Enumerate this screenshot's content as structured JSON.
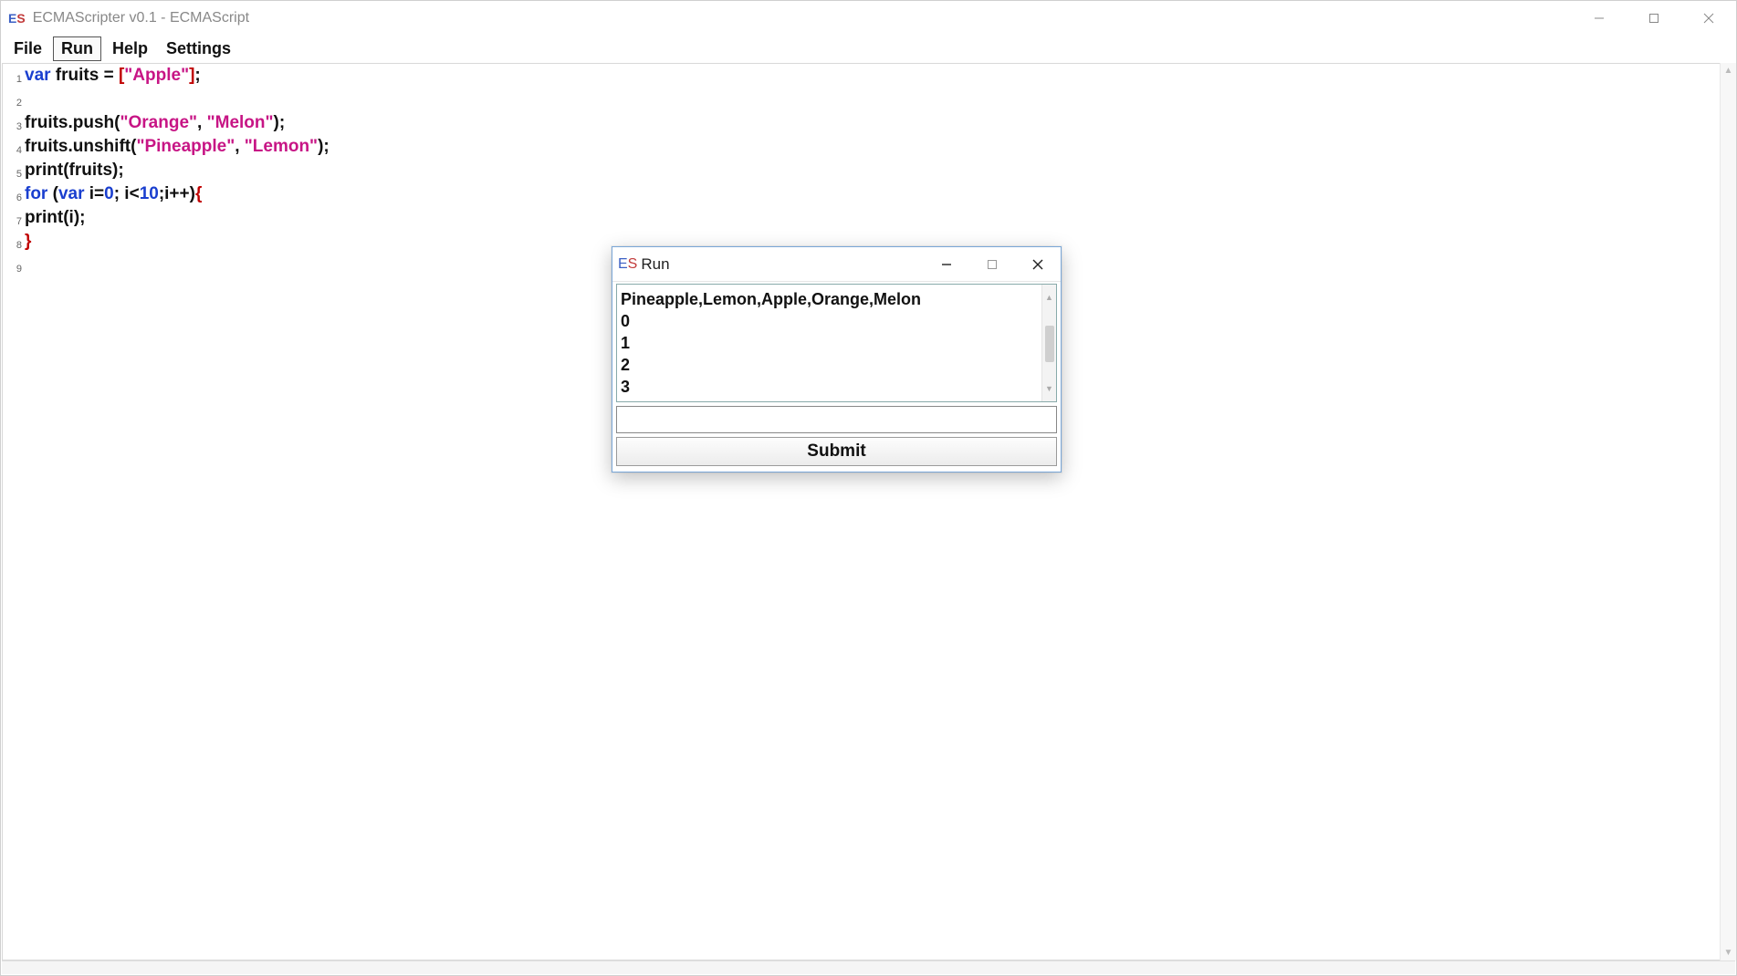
{
  "window": {
    "title": "ECMAScripter v0.1 - ECMAScript",
    "icon_text_E": "E",
    "icon_text_S": "S"
  },
  "menu": {
    "items": [
      "File",
      "Run",
      "Help",
      "Settings"
    ],
    "active_index": 1
  },
  "editor": {
    "line_numbers": [
      "1",
      "2",
      "3",
      "4",
      "5",
      "6",
      "7",
      "8",
      "9"
    ],
    "code_lines": [
      [
        {
          "t": "var",
          "c": "kw"
        },
        {
          "t": " fruits = ",
          "c": ""
        },
        {
          "t": "[",
          "c": "brace-red"
        },
        {
          "t": "\"Apple\"",
          "c": "str"
        },
        {
          "t": "]",
          "c": "brace-red"
        },
        {
          "t": ";",
          "c": "punct"
        }
      ],
      [],
      [
        {
          "t": "fruits.push",
          "c": ""
        },
        {
          "t": "(",
          "c": "punct"
        },
        {
          "t": "\"Orange\"",
          "c": "str"
        },
        {
          "t": ", ",
          "c": "punct"
        },
        {
          "t": "\"Melon\"",
          "c": "str"
        },
        {
          "t": ")",
          "c": "punct"
        },
        {
          "t": ";",
          "c": "punct"
        }
      ],
      [
        {
          "t": "fruits.unshift",
          "c": ""
        },
        {
          "t": "(",
          "c": "punct"
        },
        {
          "t": "\"Pineapple\"",
          "c": "str"
        },
        {
          "t": ", ",
          "c": "punct"
        },
        {
          "t": "\"Lemon\"",
          "c": "str"
        },
        {
          "t": ")",
          "c": "punct"
        },
        {
          "t": ";",
          "c": "punct"
        }
      ],
      [
        {
          "t": "print",
          "c": ""
        },
        {
          "t": "(",
          "c": "punct"
        },
        {
          "t": "fruits",
          "c": ""
        },
        {
          "t": ")",
          "c": "punct"
        },
        {
          "t": ";",
          "c": "punct"
        }
      ],
      [
        {
          "t": "for",
          "c": "kw"
        },
        {
          "t": " ",
          "c": ""
        },
        {
          "t": "(",
          "c": "punct"
        },
        {
          "t": "var",
          "c": "kw"
        },
        {
          "t": " i=",
          "c": ""
        },
        {
          "t": "0",
          "c": "num"
        },
        {
          "t": "; i<",
          "c": "punct"
        },
        {
          "t": "10",
          "c": "num"
        },
        {
          "t": ";i++",
          "c": "punct"
        },
        {
          "t": ")",
          "c": "punct"
        },
        {
          "t": "{",
          "c": "brace-red"
        }
      ],
      [
        {
          "t": "print",
          "c": ""
        },
        {
          "t": "(",
          "c": "punct"
        },
        {
          "t": "i",
          "c": ""
        },
        {
          "t": ")",
          "c": "punct"
        },
        {
          "t": ";",
          "c": "punct"
        }
      ],
      [
        {
          "t": "}",
          "c": "brace-red"
        }
      ],
      []
    ]
  },
  "run_dialog": {
    "title": "Run",
    "output_lines": [
      "Pineapple,Lemon,Apple,Orange,Melon",
      "0",
      "1",
      "2",
      "3"
    ],
    "input_value": "",
    "submit_label": "Submit"
  }
}
